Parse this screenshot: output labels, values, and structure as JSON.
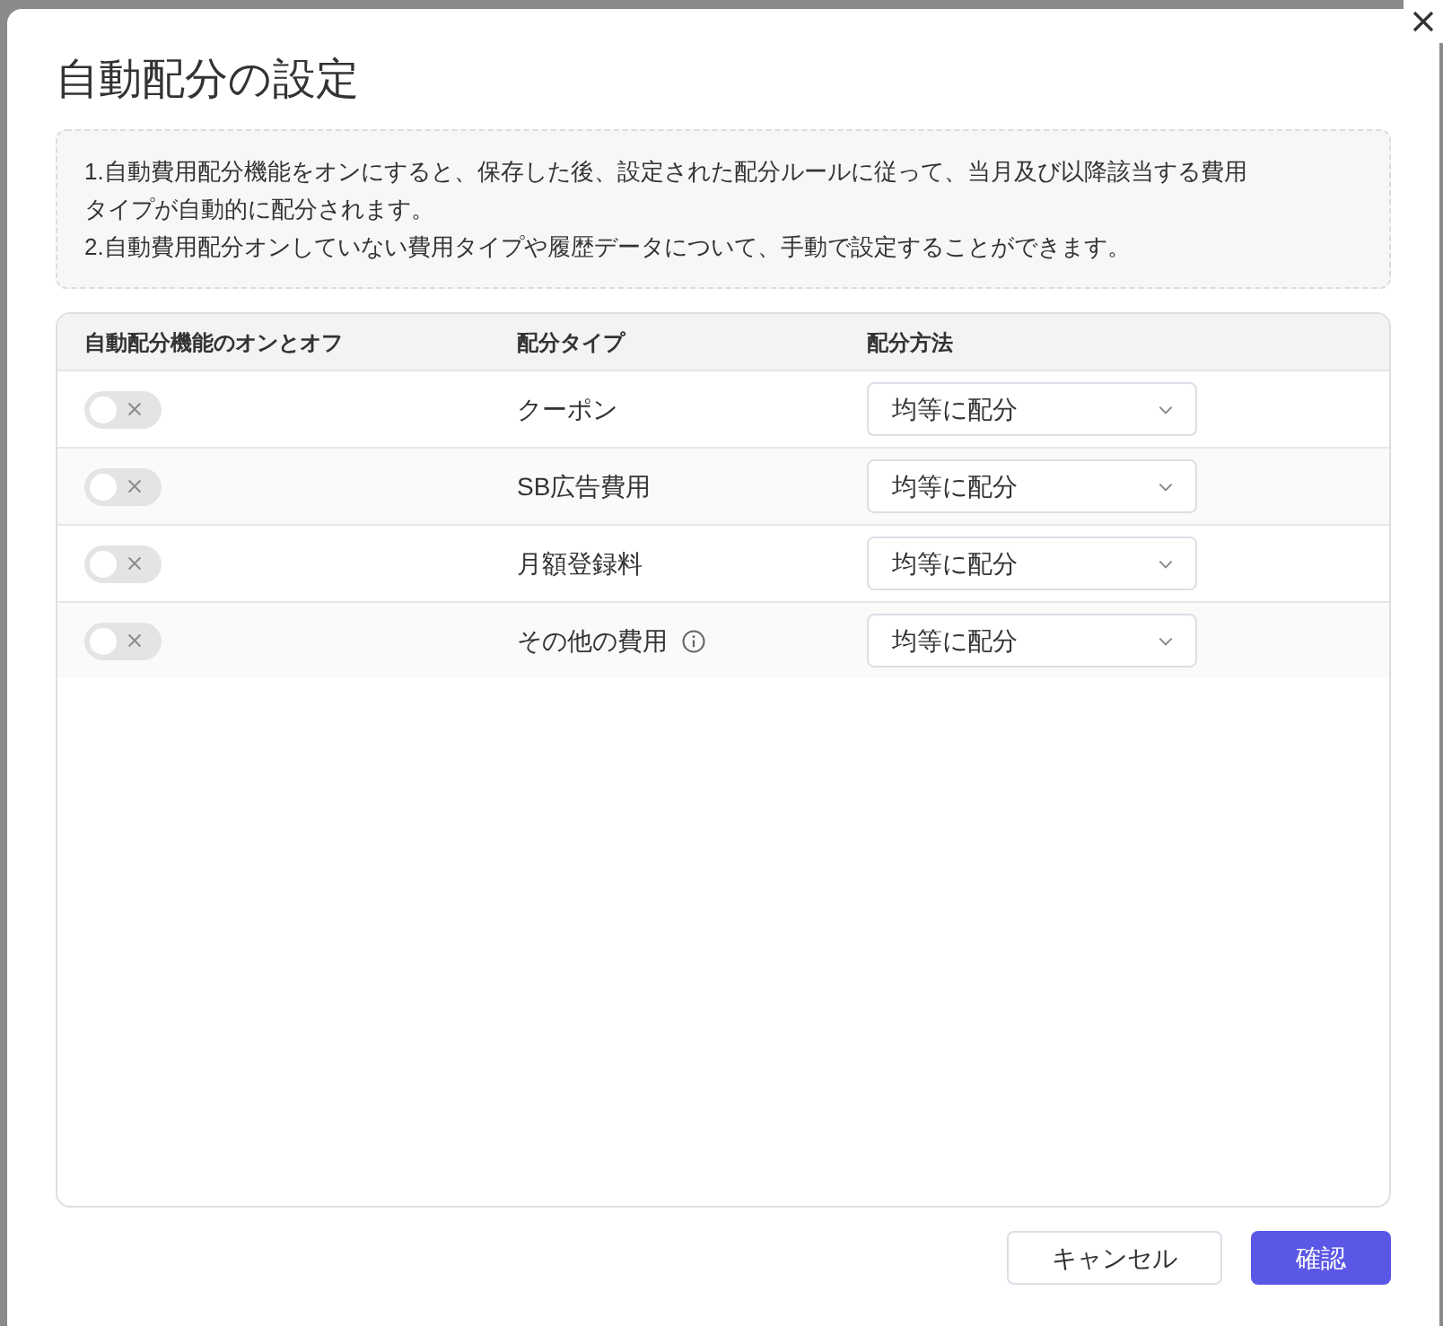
{
  "dialog": {
    "title": "自動配分の設定",
    "notice": [
      "1.自動費用配分機能をオンにすると、保存した後、設定された配分ルールに従って、当月及び以降該当する費用タイプが自動的に配分されます。",
      "2.自動費用配分オンしていない費用タイプや履歴データについて、手動で設定することができます。"
    ],
    "table": {
      "columns": [
        "自動配分機能のオンとオフ",
        "配分タイプ",
        "配分方法"
      ],
      "rows": [
        {
          "enabled": false,
          "type": "クーポン",
          "info": false,
          "method": "均等に配分"
        },
        {
          "enabled": false,
          "type": "SB広告費用",
          "info": false,
          "method": "均等に配分"
        },
        {
          "enabled": false,
          "type": "月額登録料",
          "info": false,
          "method": "均等に配分"
        },
        {
          "enabled": false,
          "type": "その他の費用",
          "info": true,
          "method": "均等に配分"
        }
      ]
    },
    "buttons": [
      {
        "label": "キャンセル",
        "kind": "secondary"
      },
      {
        "label": "確認",
        "kind": "primary"
      }
    ]
  }
}
